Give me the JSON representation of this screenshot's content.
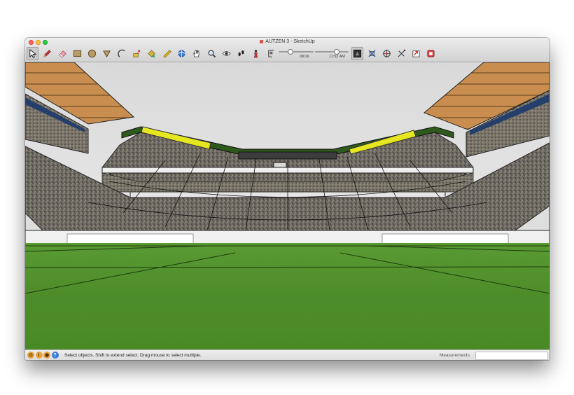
{
  "window": {
    "title": "AUTZEN 3 - SketchUp"
  },
  "toolbar": {
    "tools": [
      {
        "name": "select-tool",
        "icon": "arrow-cursor-icon",
        "active": true
      },
      {
        "name": "pencil-tool",
        "icon": "pencil-icon"
      },
      {
        "name": "eraser-tool",
        "icon": "eraser-icon"
      },
      {
        "name": "rectangle-tool",
        "icon": "rectangle-icon"
      },
      {
        "name": "circle-tool",
        "icon": "circle-icon"
      },
      {
        "name": "polygon-tool",
        "icon": "triangle-icon"
      },
      {
        "name": "arc-tool",
        "icon": "arc-icon"
      },
      {
        "name": "push-pull-tool",
        "icon": "push-pull-icon"
      },
      {
        "name": "paint-bucket-tool",
        "icon": "paint-bucket-icon"
      },
      {
        "name": "tape-measure-tool",
        "icon": "tape-measure-icon"
      },
      {
        "name": "orbit-tool",
        "icon": "orbit-icon"
      },
      {
        "name": "pan-tool",
        "icon": "hand-icon"
      },
      {
        "name": "zoom-tool",
        "icon": "magnifier-icon"
      },
      {
        "name": "look-around-tool",
        "icon": "eye-icon"
      },
      {
        "name": "walk-tool",
        "icon": "footprints-icon"
      },
      {
        "name": "position-camera-tool",
        "icon": "person-icon"
      },
      {
        "name": "shadows-toggle",
        "icon": "shadow-settings-icon"
      }
    ],
    "tools_right": [
      {
        "name": "style-button",
        "icon": "monochrome-style-icon",
        "active": true
      },
      {
        "name": "zoom-extents-button",
        "icon": "zoom-extents-icon"
      },
      {
        "name": "3d-warehouse-button",
        "icon": "warehouse-icon"
      },
      {
        "name": "extension-warehouse-button",
        "icon": "extension-icon"
      },
      {
        "name": "share-model-button",
        "icon": "share-model-icon"
      },
      {
        "name": "layout-button",
        "icon": "layout-icon"
      }
    ],
    "date_label": "09/16",
    "time_label": "11:52 AM",
    "date_value": 0.32,
    "time_value": 0.62
  },
  "status": {
    "instruction": "Select objects. Shift to extend select. Drag mouse to select multiple.",
    "measurements_label": "Measurements",
    "measurements_value": ""
  },
  "colors": {
    "close": "#ff5f57",
    "minimize": "#febc2e",
    "zoom": "#28c840",
    "sky": "#dedede",
    "grass": "#4f8d2a",
    "stadium_green": "#2f5a1d",
    "light_bank": "#e6e621",
    "canopy": "#c08545"
  }
}
